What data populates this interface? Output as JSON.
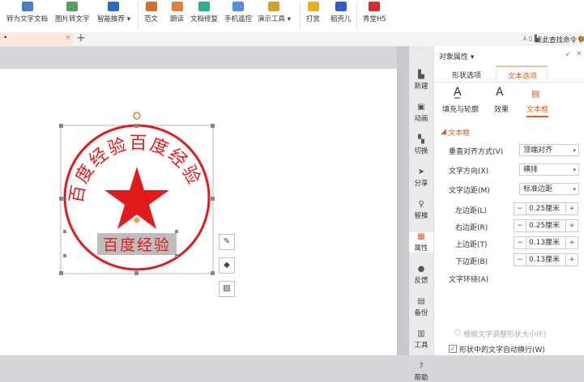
{
  "toolbar": {
    "items": [
      {
        "label": "转为文字文档",
        "icon": "convert-doc-icon",
        "color": "#4a7fc1"
      },
      {
        "label": "图片转文字",
        "icon": "image-to-text-icon",
        "color": "#55a060"
      },
      {
        "label": "智能推荐 ▾",
        "icon": "recommend-icon",
        "color": "#2a6bbf"
      },
      {
        "label": "范文",
        "icon": "template-icon",
        "color": "#d07030"
      },
      {
        "label": "朗读",
        "icon": "read-aloud-icon",
        "color": "#e08040"
      },
      {
        "label": "文档修复",
        "icon": "doc-repair-icon",
        "color": "#30b090"
      },
      {
        "label": "手机遥控",
        "icon": "phone-remote-icon",
        "color": "#5590e0"
      },
      {
        "label": "演示工具 ▾",
        "icon": "presentation-tools-icon",
        "color": "#d0a030"
      },
      {
        "label": "打赏",
        "icon": "reward-icon",
        "color": "#e8b020"
      },
      {
        "label": "稻壳儿",
        "icon": "docer-icon",
        "color": "#3060c0"
      },
      {
        "label": "秀堂H5",
        "icon": "h5-icon",
        "color": "#d03030"
      }
    ]
  },
  "tabbar": {
    "tab_label": "•",
    "close": "×",
    "add": "+",
    "search": "点此查找命令 (Alt+Q"
  },
  "stamp": {
    "arc_text": "百度经验百度经验",
    "bottom_text": "百度经验",
    "color": "#e11b1b"
  },
  "sidebar": {
    "items": [
      {
        "label": "新建",
        "icon": "new-icon"
      },
      {
        "label": "动画",
        "icon": "animation-icon"
      },
      {
        "label": "切换",
        "icon": "transition-icon"
      },
      {
        "label": "分享",
        "icon": "share-icon"
      },
      {
        "label": "智推",
        "icon": "smart-push-icon"
      },
      {
        "label": "属性",
        "icon": "properties-icon"
      },
      {
        "label": "反馈",
        "icon": "feedback-icon"
      },
      {
        "label": "备份",
        "icon": "backup-icon"
      },
      {
        "label": "工具",
        "icon": "tools-icon"
      },
      {
        "label": "帮助",
        "icon": "help-icon"
      }
    ]
  },
  "panel": {
    "title": "对象属性 ▾",
    "tabs": [
      "形状选项",
      "文本选项"
    ],
    "subtabs": [
      "填充与轮廓",
      "效果",
      "文本框"
    ],
    "section": "文本框",
    "vertical_align": {
      "label": "垂直对齐方式(V)",
      "value": "顶端对齐"
    },
    "direction": {
      "label": "文字方向(X)",
      "value": "横排"
    },
    "margin_preset": {
      "label": "文字边距(M)",
      "value": "标准边距"
    },
    "margins": [
      {
        "label": "左边距(L)",
        "value": "0.25厘米"
      },
      {
        "label": "右边距(R)",
        "value": "0.25厘米"
      },
      {
        "label": "上边距(T)",
        "value": "0.13厘米"
      },
      {
        "label": "下边距(B)",
        "value": "0.13厘米"
      }
    ],
    "text_wrap_label": "文字环绕(A)",
    "autofit_label": "根据文字调整形状大小(F)",
    "wrap_checkbox": {
      "label": "形状中的文字自动换行(W)",
      "checked": true
    },
    "accent": "#e05a1a"
  }
}
